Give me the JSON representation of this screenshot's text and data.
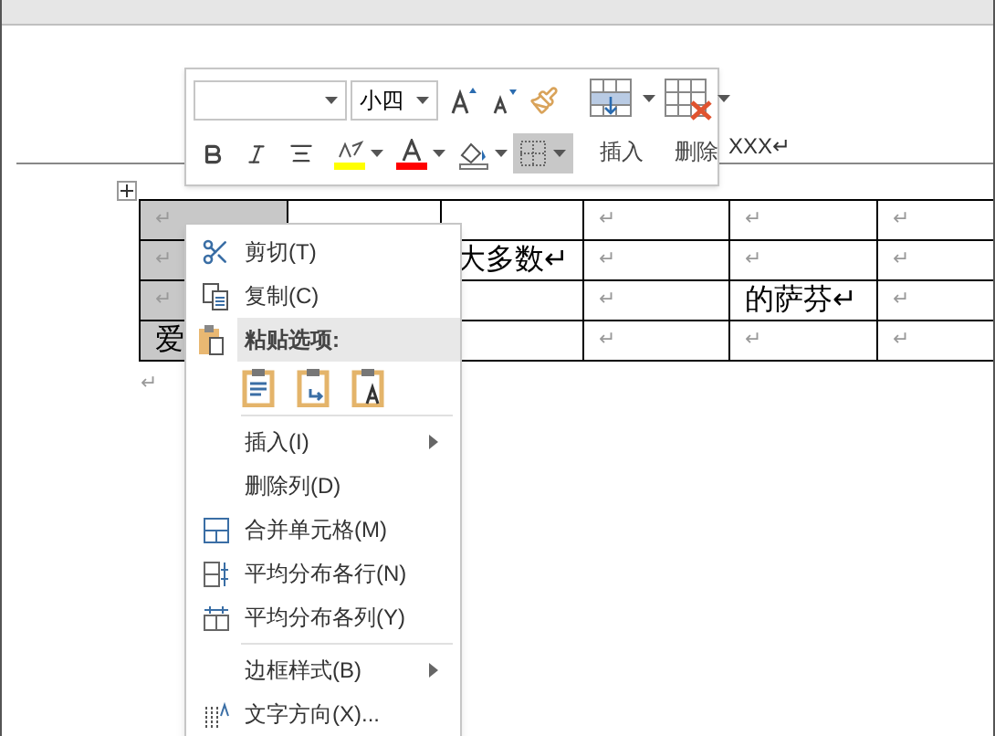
{
  "document": {
    "heading_tail": "XXX↵",
    "after_table": "↵"
  },
  "table": {
    "columns": [
      {
        "selected": true
      },
      {
        "selected": false
      },
      {
        "selected": false
      },
      {
        "selected": false
      },
      {
        "selected": false
      },
      {
        "selected": false
      }
    ],
    "rows": [
      [
        "↵",
        null,
        null,
        "↵",
        "↵",
        "↵"
      ],
      [
        "↵",
        null,
        "大多数↵",
        "↵",
        "↵",
        "↵"
      ],
      [
        "↵",
        null,
        null,
        "↵",
        "的萨芬↵",
        "↵"
      ],
      [
        "爱",
        null,
        null,
        "↵",
        "↵",
        "↵"
      ]
    ]
  },
  "mini_toolbar": {
    "font_size": "小四",
    "insert_label": "插入",
    "delete_label": "删除",
    "borders_selected": true
  },
  "context_menu": [
    {
      "kind": "command",
      "label": "剪切(T)",
      "submenu": false
    },
    {
      "kind": "command",
      "label": "复制(C)",
      "submenu": false
    },
    {
      "kind": "header",
      "label": "粘贴选项:"
    },
    {
      "kind": "paste_options"
    },
    {
      "kind": "separator"
    },
    {
      "kind": "command",
      "label": "插入(I)",
      "submenu": true
    },
    {
      "kind": "command",
      "label": "删除列(D)",
      "submenu": false
    },
    {
      "kind": "command",
      "label": "合并单元格(M)",
      "submenu": false
    },
    {
      "kind": "command",
      "label": "平均分布各行(N)",
      "submenu": false
    },
    {
      "kind": "command",
      "label": "平均分布各列(Y)",
      "submenu": false
    },
    {
      "kind": "separator"
    },
    {
      "kind": "command",
      "label": "边框样式(B)",
      "submenu": true
    },
    {
      "kind": "command",
      "label": "文字方向(X)...",
      "submenu": false
    }
  ]
}
